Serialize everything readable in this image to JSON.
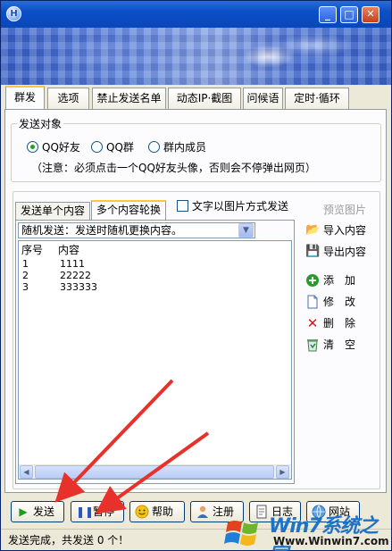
{
  "title_bar": {
    "app_icon": "H",
    "min": "_",
    "max": "□",
    "close": "✕"
  },
  "tabs": [
    "群发",
    "选项",
    "禁止发送名单",
    "动态IP·截图",
    "问候语",
    "定时·循环"
  ],
  "target_group": {
    "title": "发送对象",
    "options": [
      "QQ好友",
      "QQ群",
      "群内成员"
    ],
    "note": "（注意：必须点击一个QQ好友头像，否则会不停弹出网页）"
  },
  "inner_tabs": [
    "发送单个内容",
    "多个内容轮换"
  ],
  "image_mode_checkbox": "文字以图片方式发送",
  "mode_select": "随机发送：发送时随机更换内容。",
  "list": {
    "columns": [
      "序号",
      "内容"
    ],
    "rows": [
      {
        "index": "1",
        "content": "1111"
      },
      {
        "index": "2",
        "content": "22222"
      },
      {
        "index": "3",
        "content": "333333"
      }
    ]
  },
  "side_panel": {
    "preview": "预览图片",
    "buttons": [
      "导入内容",
      "导出内容",
      "添　加",
      "修　改",
      "删　除",
      "清　空"
    ]
  },
  "bottom_buttons": [
    "发送",
    "暂停",
    "帮助",
    "注册",
    "日志",
    "网站"
  ],
  "status": "发送完成，共发送 0 个！",
  "watermark": {
    "text": "Win7系统之家",
    "url": "Www.Winwin7.com"
  },
  "colors": {
    "titlebar": "#0b4fc8",
    "tab_highlight": "#ffc83c",
    "annotation_arrow": "#e8312a",
    "watermark_blue": "#1e73c8"
  }
}
